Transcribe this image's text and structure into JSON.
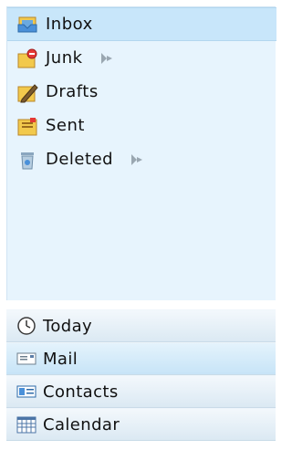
{
  "folders": [
    {
      "label": "Inbox",
      "icon": "inbox-icon",
      "selected": true,
      "has_arrow": false
    },
    {
      "label": "Junk",
      "icon": "junk-icon",
      "selected": false,
      "has_arrow": true
    },
    {
      "label": "Drafts",
      "icon": "drafts-icon",
      "selected": false,
      "has_arrow": false
    },
    {
      "label": "Sent",
      "icon": "sent-icon",
      "selected": false,
      "has_arrow": false
    },
    {
      "label": "Deleted",
      "icon": "deleted-icon",
      "selected": false,
      "has_arrow": true
    }
  ],
  "nav": [
    {
      "label": "Today",
      "icon": "clock-icon",
      "selected": false
    },
    {
      "label": "Mail",
      "icon": "mail-icon",
      "selected": true
    },
    {
      "label": "Contacts",
      "icon": "contacts-icon",
      "selected": false
    },
    {
      "label": "Calendar",
      "icon": "calendar-icon",
      "selected": false
    }
  ],
  "colors": {
    "pane_bg": "#e7f4fd",
    "selected_bg": "#c8e6fa",
    "nav_bg": "#dbe9f3"
  }
}
